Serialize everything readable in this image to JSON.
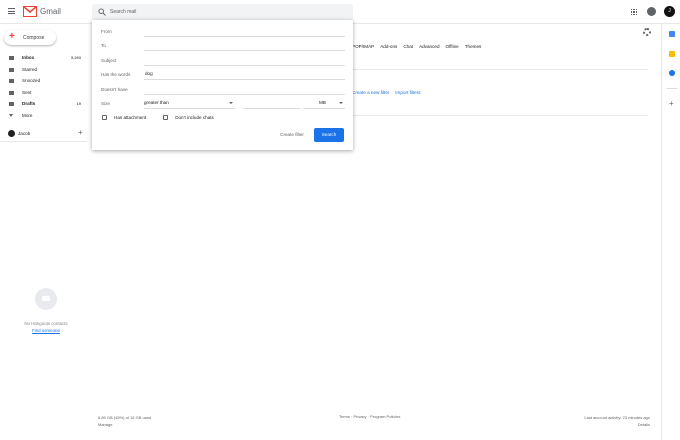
{
  "header": {
    "app_name": "Gmail",
    "search_placeholder": "Search mail",
    "account_initial": "J",
    "icons": [
      "menu-icon",
      "gmail-logo",
      "search-icon",
      "apps-icon",
      "notifications-icon"
    ]
  },
  "sidebar": {
    "compose_label": "Compose",
    "items": [
      {
        "label": "Inbox",
        "count": "5,293",
        "icon": "inbox-icon",
        "bold": true
      },
      {
        "label": "Starred",
        "count": "",
        "icon": "star-icon",
        "bold": false
      },
      {
        "label": "Snoozed",
        "count": "",
        "icon": "clock-icon",
        "bold": false
      },
      {
        "label": "Sent",
        "count": "",
        "icon": "send-icon",
        "bold": false
      },
      {
        "label": "Drafts",
        "count": "19",
        "icon": "draft-icon",
        "bold": true
      },
      {
        "label": "More",
        "count": "",
        "icon": "chevron-down-icon",
        "bold": false
      }
    ],
    "user_name": "Jacob",
    "add_label": "+",
    "hangouts_empty": "No Hangouts contacts",
    "find_someone": "Find someone"
  },
  "settings": {
    "tabs": [
      "POP/IMAP",
      "Add-ons",
      "Chat",
      "Advanced",
      "Offline",
      "Themes"
    ],
    "filter_links": [
      "Create a new filter",
      "Import filters"
    ]
  },
  "search_options": {
    "from_label": "From",
    "from_value": "",
    "to_label": "To",
    "to_value": "",
    "subject_label": "Subject",
    "subject_value": "",
    "has_words_label": "Has the words",
    "has_words_value": "dog",
    "doesnt_have_label": "Doesn't have",
    "doesnt_have_value": "",
    "size_label": "Size",
    "size_operator": "greater than",
    "size_value": "",
    "size_unit": "MB",
    "has_attachment_label": "Has attachment",
    "dont_include_chats_label": "Don't include chats",
    "create_filter_label": "Create filter",
    "search_label": "Search"
  },
  "footer": {
    "storage": "6.89 GB (45%) of 15 GB used",
    "manage": "Manage",
    "links": "Terms · Privacy · Program Policies",
    "activity": "Last account activity: 23 minutes ago",
    "details": "Details"
  },
  "colors": {
    "accent_blue": "#1a73e8",
    "gmail_red": "#ea4335",
    "calendar_blue": "#4285f4",
    "keep_yellow": "#fbbc04",
    "tasks_blue": "#1a73e8"
  }
}
